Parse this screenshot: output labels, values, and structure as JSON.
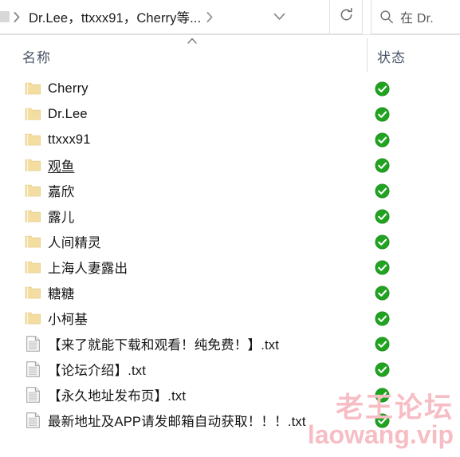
{
  "toolbar": {
    "breadcrumb": {
      "root_icon": "drive-icon",
      "separator_icon": "chevron-right-icon",
      "path_text": "Dr.Lee，ttxxx91，Cherry等...",
      "trailing_separator_icon": "chevron-right-icon"
    },
    "dropdown_icon": "chevron-down-icon",
    "refresh_icon": "refresh-icon",
    "refresh_label": "刷新",
    "search": {
      "icon": "search-icon",
      "placeholder": "在 Dr."
    }
  },
  "columns": {
    "name_header": "名称",
    "status_header": "状态",
    "sort_caret_icon": "caret-up-icon"
  },
  "files": [
    {
      "name": "Cherry",
      "icon": "folder-icon",
      "status": "sync-complete-icon",
      "hovered": false
    },
    {
      "name": "Dr.Lee",
      "icon": "folder-icon",
      "status": "sync-complete-icon",
      "hovered": false
    },
    {
      "name": "ttxxx91",
      "icon": "folder-icon",
      "status": "sync-complete-icon",
      "hovered": false
    },
    {
      "name": "观鱼",
      "icon": "folder-icon",
      "status": "sync-complete-icon",
      "hovered": true
    },
    {
      "name": "嘉欣",
      "icon": "folder-icon",
      "status": "sync-complete-icon",
      "hovered": false
    },
    {
      "name": "露儿",
      "icon": "folder-icon",
      "status": "sync-complete-icon",
      "hovered": false
    },
    {
      "name": "人间精灵",
      "icon": "folder-icon",
      "status": "sync-complete-icon",
      "hovered": false
    },
    {
      "name": "上海人妻露出",
      "icon": "folder-icon",
      "status": "sync-complete-icon",
      "hovered": false
    },
    {
      "name": "糖糖",
      "icon": "folder-icon",
      "status": "sync-complete-icon",
      "hovered": false
    },
    {
      "name": "小柯基",
      "icon": "folder-icon",
      "status": "sync-complete-icon",
      "hovered": false
    },
    {
      "name": "【来了就能下载和观看！纯免费！】.txt",
      "icon": "text-file-icon",
      "status": "sync-complete-icon",
      "hovered": false
    },
    {
      "name": "【论坛介绍】.txt",
      "icon": "text-file-icon",
      "status": "sync-complete-icon",
      "hovered": false
    },
    {
      "name": "【永久地址发布页】.txt",
      "icon": "text-file-icon",
      "status": "sync-complete-icon",
      "hovered": false
    },
    {
      "name": "最新地址及APP请发邮箱自动获取！！！.txt",
      "icon": "text-file-icon",
      "status": "sync-complete-icon",
      "hovered": false
    }
  ],
  "watermark": {
    "chinese": "老王论坛",
    "latin": "laowang.vip",
    "color": "#f7bdc4"
  },
  "colors": {
    "status_green": "#21a321",
    "folder_yellow": "#f5dfa0",
    "header_text": "#4a5468",
    "body_text": "#141414"
  }
}
